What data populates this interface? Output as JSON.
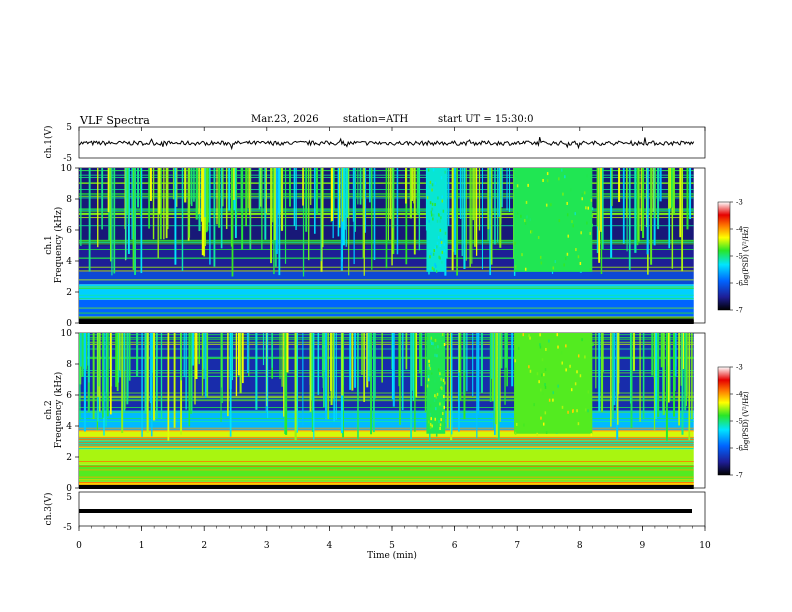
{
  "header": {
    "title": "VLF  Spectra",
    "date": "Mar.23, 2026",
    "station": "station=ATH",
    "start_ut": "start  UT  =   15:30:0"
  },
  "chart_data": [
    {
      "type": "line",
      "ylabel": "ch.1(V)",
      "ylim": [
        -5,
        5
      ],
      "yticks": [
        "5",
        "-5"
      ],
      "xlim": [
        0,
        10
      ],
      "description": "waveform roughly flat near 0 V with small noise"
    },
    {
      "type": "heatmap",
      "ylabel_top": "ch.1",
      "ylabel": "Frequency  (kHz)",
      "ylim": [
        0,
        10
      ],
      "yticks": [
        "0",
        "2",
        "4",
        "6",
        "8",
        "10"
      ],
      "xlim": [
        0,
        10
      ],
      "colorbar": {
        "label": "log(PSD) (V²/Hz)",
        "ticks": [
          "-3",
          "-4",
          "-5",
          "-6",
          "-7"
        ],
        "range": [
          -7,
          -3
        ]
      },
      "segments": [
        {
          "x_start": 5.55,
          "x_end": 5.85,
          "f_low": 3.3,
          "f_high": 10,
          "level": -5.3
        },
        {
          "x_start": 6.95,
          "x_end": 8.2,
          "f_low": 3.3,
          "f_high": 10,
          "level": -5.0
        }
      ]
    },
    {
      "type": "heatmap",
      "ylabel_top": "ch.2",
      "ylabel": "Frequency  (kHz)",
      "ylim": [
        0,
        10
      ],
      "yticks": [
        "0",
        "2",
        "4",
        "6",
        "8",
        "10"
      ],
      "xlim": [
        0,
        10
      ],
      "colorbar": {
        "label": "log(PSD) (V²/Hz)",
        "ticks": [
          "-3",
          "-4",
          "-5",
          "-6",
          "-7"
        ],
        "range": [
          -7,
          -3
        ]
      },
      "segments": [
        {
          "x_start": 5.55,
          "x_end": 5.85,
          "f_low": 3.5,
          "f_high": 10,
          "level": -5.0
        },
        {
          "x_start": 6.95,
          "x_end": 8.2,
          "f_low": 3.5,
          "f_high": 10,
          "level": -4.8
        }
      ]
    },
    {
      "type": "line",
      "ylabel": "ch.3(V)",
      "ylim": [
        -5,
        5
      ],
      "yticks": [
        "5",
        "-5"
      ],
      "xlim": [
        0,
        10
      ],
      "xlabel": "Time  (min)",
      "xticks": [
        "0",
        "1",
        "2",
        "3",
        "4",
        "5",
        "6",
        "7",
        "8",
        "9",
        "10"
      ],
      "description": "flat thick line near -2 V"
    }
  ],
  "colors": {
    "axis": "#000000",
    "background": "#ffffff"
  }
}
